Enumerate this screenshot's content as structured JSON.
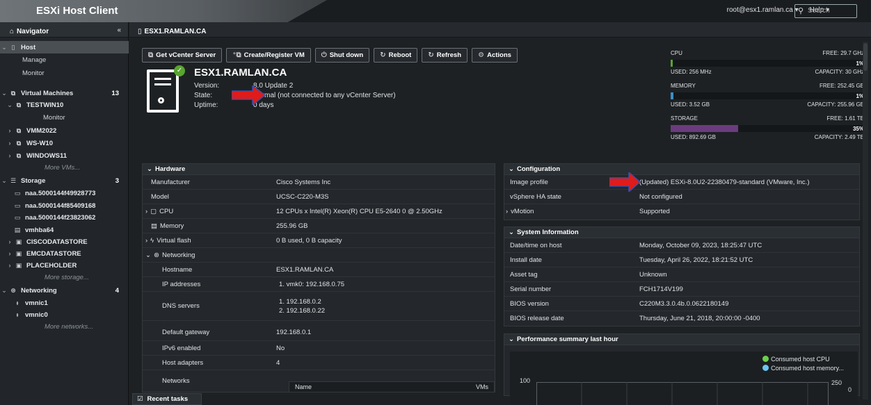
{
  "header": {
    "title": "ESXi Host Client",
    "user": "root@esx1.ramlan.ca ▾",
    "help": "Help ▾",
    "search_placeholder": "Search"
  },
  "navigator": {
    "title": "Navigator",
    "items": [
      {
        "label": "Host",
        "type": "section",
        "selected": true
      },
      {
        "label": "Manage",
        "type": "sub"
      },
      {
        "label": "Monitor",
        "type": "sub"
      },
      {
        "label": "Virtual Machines",
        "type": "section",
        "count": "13"
      },
      {
        "label": "TESTWIN10",
        "type": "vm"
      },
      {
        "label": "Monitor",
        "type": "subsub"
      },
      {
        "label": "VMM2022",
        "type": "vm"
      },
      {
        "label": "WS-W10",
        "type": "vm"
      },
      {
        "label": "WINDOWS11",
        "type": "vm"
      },
      {
        "label": "More VMs...",
        "type": "more"
      },
      {
        "label": "Storage",
        "type": "section",
        "count": "3"
      },
      {
        "label": "naa.5000144f49928773",
        "type": "disk"
      },
      {
        "label": "naa.5000144f85409168",
        "type": "disk"
      },
      {
        "label": "naa.5000144f23823062",
        "type": "disk"
      },
      {
        "label": "vmhba64",
        "type": "disk"
      },
      {
        "label": "CISCODATASTORE",
        "type": "ds"
      },
      {
        "label": "EMCDATASTORE",
        "type": "ds"
      },
      {
        "label": "PLACEHOLDER",
        "type": "ds"
      },
      {
        "label": "More storage...",
        "type": "more"
      },
      {
        "label": "Networking",
        "type": "section",
        "count": "4"
      },
      {
        "label": "vmnic1",
        "type": "nic"
      },
      {
        "label": "vmnic0",
        "type": "nic"
      },
      {
        "label": "More networks...",
        "type": "more"
      }
    ]
  },
  "breadcrumb": "ESX1.RAMLAN.CA",
  "toolbar": {
    "get_vcenter": "Get vCenter Server",
    "create_vm": "Create/Register VM",
    "shut_down": "Shut down",
    "reboot": "Reboot",
    "refresh": "Refresh",
    "actions": "Actions"
  },
  "host": {
    "name": "ESX1.RAMLAN.CA",
    "version_label": "Version:",
    "version": "8.0 Update 2",
    "state_label": "State:",
    "state": "Normal (not connected to any vCenter Server)",
    "uptime_label": "Uptime:",
    "uptime": "0 days"
  },
  "resources": {
    "cpu": {
      "label": "CPU",
      "free": "FREE: 29.7 GHz",
      "pct": "1%",
      "used": "USED: 256 MHz",
      "capacity": "CAPACITY: 30 GHz",
      "fraction": 0.01,
      "color": "#58a52f"
    },
    "memory": {
      "label": "MEMORY",
      "free": "FREE: 252.45 GB",
      "pct": "1%",
      "used": "USED: 3.52 GB",
      "capacity": "CAPACITY: 255.96 GB",
      "fraction": 0.014,
      "color": "#3b8fc4"
    },
    "storage": {
      "label": "STORAGE",
      "free": "FREE: 1.61 TB",
      "pct": "35%",
      "used": "USED: 892.69 GB",
      "capacity": "CAPACITY: 2.49 TB",
      "fraction": 0.35,
      "color": "#6b3c7d"
    }
  },
  "hardware": {
    "title": "Hardware",
    "rows": [
      {
        "k": "Manufacturer",
        "v": "Cisco Systems Inc"
      },
      {
        "k": "Model",
        "v": "UCSC-C220-M3S"
      },
      {
        "k": "CPU",
        "v": "12 CPUs x Intel(R) Xeon(R) CPU E5-2640 0 @ 2.50GHz"
      },
      {
        "k": "Memory",
        "v": "255.96 GB"
      },
      {
        "k": "Virtual flash",
        "v": "0 B used, 0 B capacity"
      },
      {
        "k": "Networking",
        "v": ""
      },
      {
        "k": "Hostname",
        "v": "ESX1.RAMLAN.CA"
      },
      {
        "k": "IP addresses",
        "v": "1. vmk0: 192.168.0.75"
      },
      {
        "k": "DNS servers",
        "v": "1. 192.168.0.2"
      },
      {
        "k": "",
        "v": "2. 192.168.0.22"
      },
      {
        "k": "Default gateway",
        "v": "192.168.0.1"
      },
      {
        "k": "IPv6 enabled",
        "v": "No"
      },
      {
        "k": "Host adapters",
        "v": "4"
      },
      {
        "k": "Networks",
        "v": ""
      }
    ],
    "net_col_name": "Name",
    "net_col_vms": "VMs"
  },
  "configuration": {
    "title": "Configuration",
    "rows": [
      {
        "k": "Image profile",
        "v": "(Updated) ESXi-8.0U2-22380479-standard (VMware, Inc.)"
      },
      {
        "k": "vSphere HA state",
        "v": "Not configured"
      },
      {
        "k": "vMotion",
        "v": "Supported"
      }
    ]
  },
  "system_info": {
    "title": "System Information",
    "rows": [
      {
        "k": "Date/time on host",
        "v": "Monday, October 09, 2023, 18:25:47 UTC"
      },
      {
        "k": "Install date",
        "v": "Tuesday, April 26, 2022, 18:21:52 UTC"
      },
      {
        "k": "Asset tag",
        "v": "Unknown"
      },
      {
        "k": "Serial number",
        "v": "FCH1714V199"
      },
      {
        "k": "BIOS version",
        "v": "C220M3.3.0.4b.0.0622180149"
      },
      {
        "k": "BIOS release date",
        "v": "Thursday, June 21, 2018, 20:00:00 -0400"
      }
    ]
  },
  "performance": {
    "title": "Performance summary last hour",
    "legend_cpu": "Consumed host CPU",
    "legend_mem": "Consumed host memory...",
    "y_left": "100",
    "y_right": "250",
    "y_right2": "0"
  },
  "recent_tasks": "Recent tasks"
}
